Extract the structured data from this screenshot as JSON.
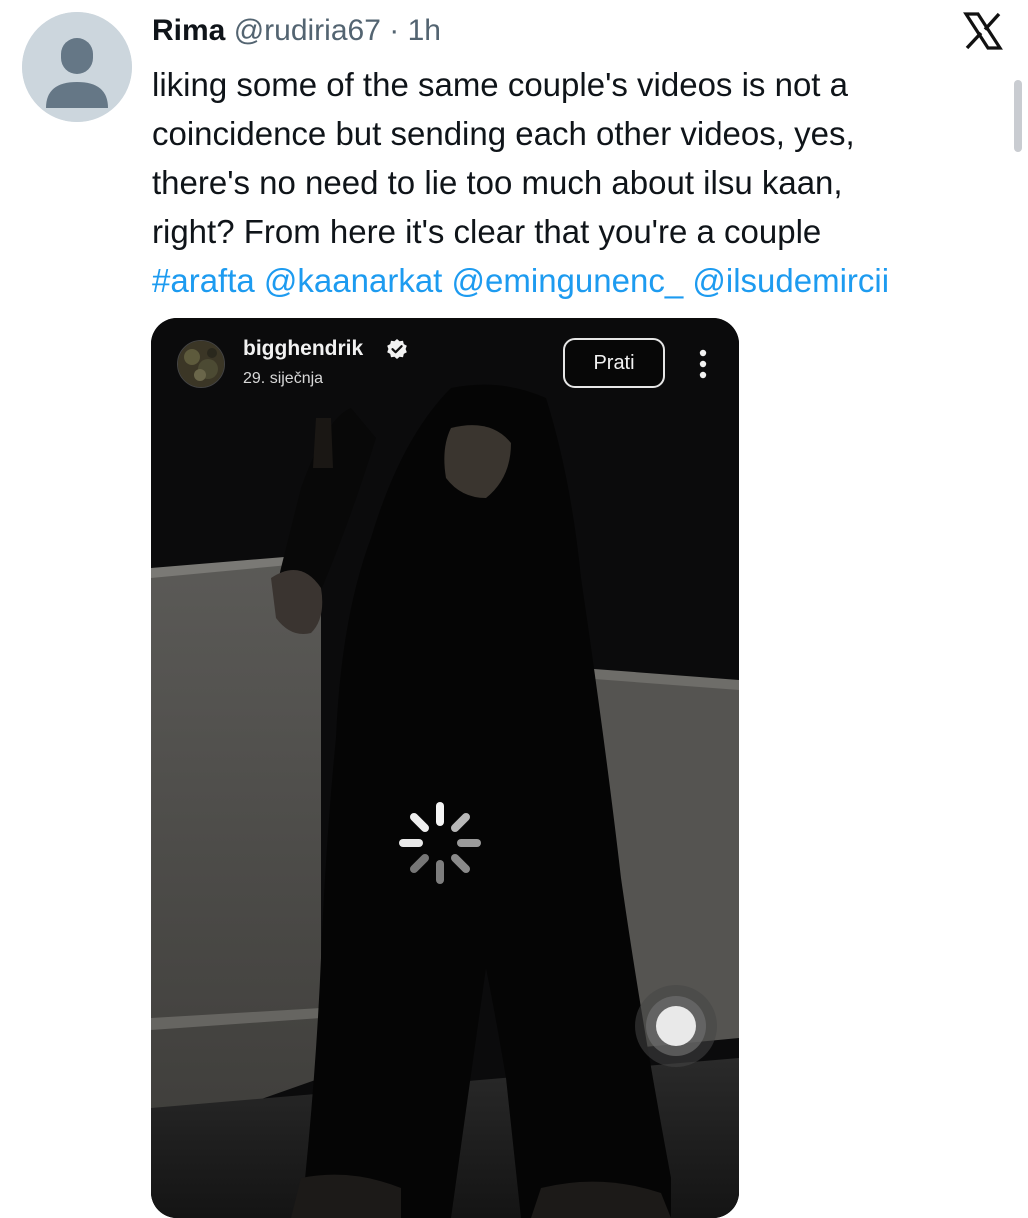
{
  "tweet": {
    "author_name": "Rima",
    "author_handle": "@rudiria67",
    "separator": "·",
    "time": "1h",
    "text_lines": [
      "liking some of the same couple's videos is not a",
      "coincidence but sending each other videos, yes,",
      "there's no need to lie too much about ilsu kaan,",
      "right? From here it's clear that you're a couple"
    ],
    "tags": [
      "#arafta",
      "@kaanarkat",
      "@emingunenc_",
      "@ilsudemircii"
    ],
    "platform_icon": "x-logo-icon",
    "link_color": "#1d9bf0"
  },
  "media": {
    "username": "bigghendrik",
    "verified_icon": "verified-badge-icon",
    "date": "29. siječnja",
    "follow_label": "Prati",
    "more_icon": "more-vertical-icon",
    "loading_icon": "loading-spinner-icon",
    "assistive_icon": "assistive-touch-icon"
  }
}
